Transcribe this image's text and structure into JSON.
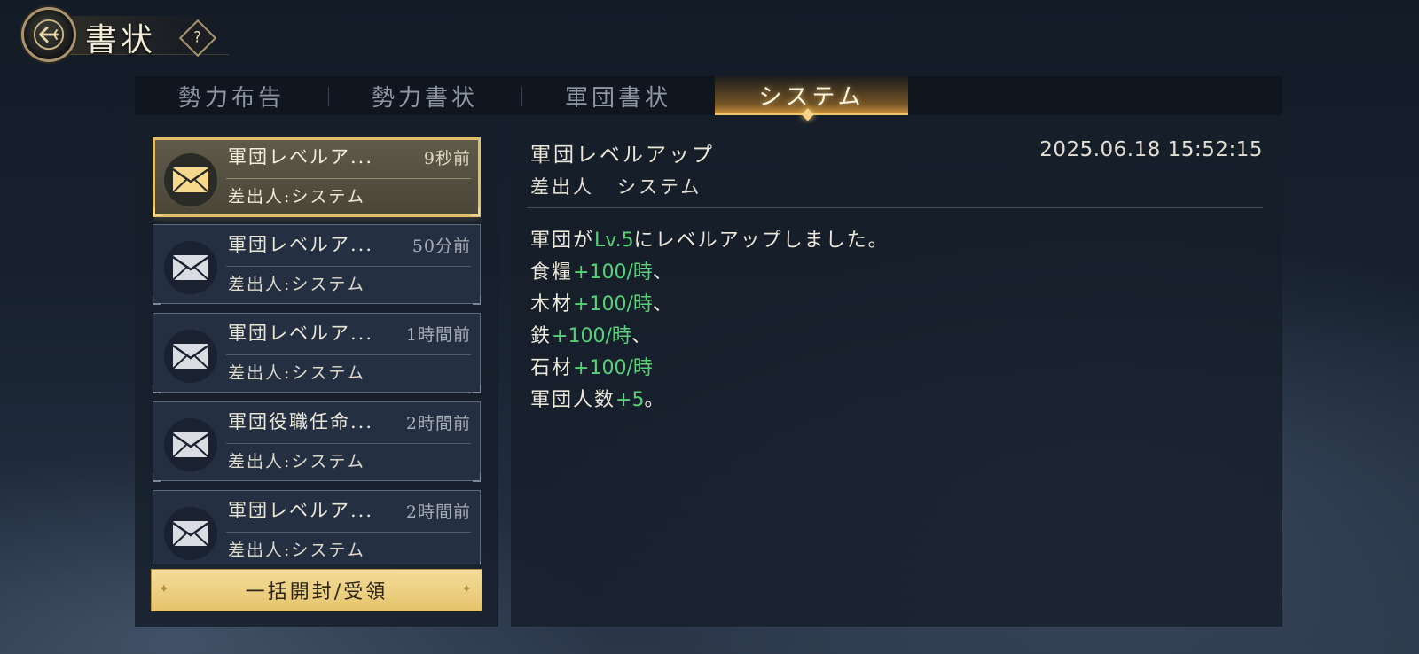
{
  "header": {
    "title": "書状",
    "help_label": "?"
  },
  "tabs": [
    {
      "label": "勢力布告",
      "active": false
    },
    {
      "label": "勢力書状",
      "active": false
    },
    {
      "label": "軍団書状",
      "active": false
    },
    {
      "label": "システム",
      "active": true
    }
  ],
  "mail_list": [
    {
      "title": "軍団レベルア...",
      "time": "9秒前",
      "sender": "差出人:システム",
      "selected": true
    },
    {
      "title": "軍団レベルア...",
      "time": "50分前",
      "sender": "差出人:システム",
      "selected": false
    },
    {
      "title": "軍団レベルア...",
      "time": "1時間前",
      "sender": "差出人:システム",
      "selected": false
    },
    {
      "title": "軍団役職任命...",
      "time": "2時間前",
      "sender": "差出人:システム",
      "selected": false
    },
    {
      "title": "軍団レベルア...",
      "time": "2時間前",
      "sender": "差出人:システム",
      "selected": false
    }
  ],
  "bulk_button_label": "一括開封/受領",
  "detail": {
    "title": "軍団レベルアップ",
    "date": "2025.06.18 15:52:15",
    "sender_label": "差出人",
    "sender_value": "システム",
    "body": [
      {
        "prefix": "軍団が",
        "highlight": "Lv.5",
        "suffix": "にレベルアップしました。"
      },
      {
        "prefix": "食糧",
        "highlight": "+100/時",
        "suffix": "、"
      },
      {
        "prefix": "木材",
        "highlight": "+100/時",
        "suffix": "、"
      },
      {
        "prefix": "鉄",
        "highlight": "+100/時",
        "suffix": "、"
      },
      {
        "prefix": "石材",
        "highlight": "+100/時",
        "suffix": ""
      },
      {
        "prefix": "軍団人数",
        "highlight": "+5",
        "suffix": "。"
      }
    ]
  },
  "colors": {
    "accent_gold": "#e2bd6c",
    "highlight_green": "#58d07a",
    "button_gold": "#f3dc9a"
  },
  "icons": [
    "back-arrow-icon",
    "help-icon",
    "envelope-icon"
  ]
}
